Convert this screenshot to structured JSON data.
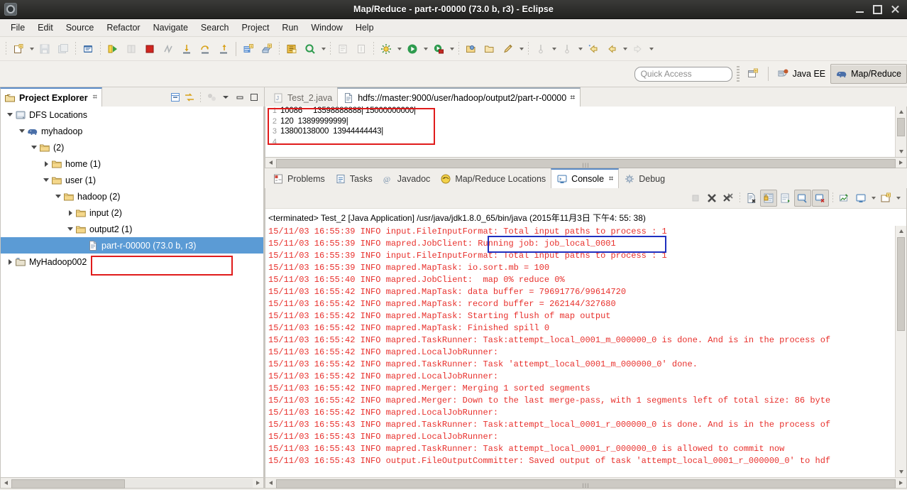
{
  "window": {
    "title": "Map/Reduce - part-r-00000 (73.0 b, r3) - Eclipse",
    "app_icon": "eclipse-icon",
    "minimize": "minimize-button",
    "maximize": "maximize-button",
    "close": "close-button"
  },
  "menubar": {
    "items": [
      "File",
      "Edit",
      "Source",
      "Refactor",
      "Navigate",
      "Search",
      "Project",
      "Run",
      "Window",
      "Help"
    ]
  },
  "toolbar": {
    "quick_access_placeholder": "Quick Access",
    "perspectives": [
      {
        "label": "Java EE",
        "icon": "javaee-perspective-icon",
        "active": false
      },
      {
        "label": "Map/Reduce",
        "icon": "elephant-icon",
        "active": true
      }
    ],
    "open_perspective_icon": "open-perspective-icon"
  },
  "project_explorer": {
    "title": "Project Explorer",
    "close_glyph": "⌗",
    "tools": [
      "collapse-all-icon",
      "link-with-editor-icon",
      "focus-icon",
      "view-menu-icon",
      "minimize-icon",
      "maximize-icon"
    ],
    "tree": [
      {
        "label": "DFS Locations",
        "indent": 0,
        "twist": "open",
        "icon": "dfs-locations-icon",
        "selected": false
      },
      {
        "label": "myhadoop",
        "indent": 1,
        "twist": "open",
        "icon": "elephant-icon",
        "selected": false
      },
      {
        "label": "(2)",
        "indent": 2,
        "twist": "open",
        "icon": "folder-icon",
        "selected": false
      },
      {
        "label": "home (1)",
        "indent": 3,
        "twist": "closed",
        "icon": "folder-icon",
        "selected": false
      },
      {
        "label": "user (1)",
        "indent": 3,
        "twist": "open",
        "icon": "folder-icon",
        "selected": false
      },
      {
        "label": "hadoop (2)",
        "indent": 4,
        "twist": "open",
        "icon": "folder-icon",
        "selected": false
      },
      {
        "label": "input (2)",
        "indent": 5,
        "twist": "closed",
        "icon": "folder-icon",
        "selected": false
      },
      {
        "label": "output2 (1)",
        "indent": 5,
        "twist": "open",
        "icon": "folder-icon",
        "selected": false
      },
      {
        "label": "part-r-00000 (73.0 b, r3)",
        "indent": 6,
        "twist": "none",
        "icon": "file-icon",
        "selected": true
      },
      {
        "label": "MyHadoop002",
        "indent": 0,
        "twist": "closed",
        "icon": "project-icon",
        "selected": false
      }
    ]
  },
  "editor": {
    "tabs": [
      {
        "label": "Test_2.java",
        "icon": "java-file-icon",
        "active": false
      },
      {
        "label": "hdfs://master:9000/user/hadoop/output2/part-r-00000",
        "icon": "file-icon",
        "active": true,
        "close_glyph": "⌗"
      }
    ],
    "lines": [
      {
        "num": "1",
        "text": "10086     13598888888| 15000000000|"
      },
      {
        "num": "2",
        "text": "120  13899999999|"
      },
      {
        "num": "3",
        "text": "13800138000  13944444443|"
      },
      {
        "num": "4",
        "text": ""
      }
    ]
  },
  "bottom_panel": {
    "tabs": [
      {
        "label": "Problems",
        "icon": "problems-icon",
        "active": false
      },
      {
        "label": "Tasks",
        "icon": "tasks-icon",
        "active": false
      },
      {
        "label": "Javadoc",
        "icon": "javadoc-icon",
        "active": false
      },
      {
        "label": "Map/Reduce Locations",
        "icon": "mapreduce-locations-icon",
        "active": false
      },
      {
        "label": "Console",
        "icon": "console-icon",
        "active": true,
        "close_glyph": "⌗"
      },
      {
        "label": "Debug",
        "icon": "debug-icon",
        "active": false
      }
    ],
    "console_tools": [
      "terminate-icon",
      "remove-launch-icon",
      "remove-all-launches-icon",
      "clear-console-icon",
      "scroll-lock-icon",
      "word-wrap-icon",
      "show-console-on-output-icon",
      "show-console-on-error-icon",
      "pin-console-icon",
      "display-selected-console-icon",
      "open-console-icon"
    ],
    "terminated_line": "<terminated> Test_2 [Java Application] /usr/java/jdk1.8.0_65/bin/java (2015年11月3日 下午4: 55: 38)",
    "highlight_text": "Running job: job_local_0001",
    "log_lines": [
      "15/11/03 16:55:39 INFO input.FileInputFormat: Total input paths to process : 1",
      "15/11/03 16:55:39 INFO mapred.JobClient: Running job: job_local_0001",
      "15/11/03 16:55:39 INFO input.FileInputFormat: Total input paths to process : 1",
      "15/11/03 16:55:39 INFO mapred.MapTask: io.sort.mb = 100",
      "15/11/03 16:55:40 INFO mapred.JobClient:  map 0% reduce 0%",
      "15/11/03 16:55:42 INFO mapred.MapTask: data buffer = 79691776/99614720",
      "15/11/03 16:55:42 INFO mapred.MapTask: record buffer = 262144/327680",
      "15/11/03 16:55:42 INFO mapred.MapTask: Starting flush of map output",
      "15/11/03 16:55:42 INFO mapred.MapTask: Finished spill 0",
      "15/11/03 16:55:42 INFO mapred.TaskRunner: Task:attempt_local_0001_m_000000_0 is done. And is in the process of",
      "15/11/03 16:55:42 INFO mapred.LocalJobRunner:",
      "15/11/03 16:55:42 INFO mapred.TaskRunner: Task 'attempt_local_0001_m_000000_0' done.",
      "15/11/03 16:55:42 INFO mapred.LocalJobRunner:",
      "15/11/03 16:55:42 INFO mapred.Merger: Merging 1 sorted segments",
      "15/11/03 16:55:42 INFO mapred.Merger: Down to the last merge-pass, with 1 segments left of total size: 86 byte",
      "15/11/03 16:55:42 INFO mapred.LocalJobRunner:",
      "15/11/03 16:55:43 INFO mapred.TaskRunner: Task:attempt_local_0001_r_000000_0 is done. And is in the process of",
      "15/11/03 16:55:43 INFO mapred.LocalJobRunner:",
      "15/11/03 16:55:43 INFO mapred.TaskRunner: Task attempt_local_0001_r_000000_0 is allowed to commit now",
      "15/11/03 16:55:43 INFO output.FileOutputCommitter: Saved output of task 'attempt_local_0001_r_000000_0' to hdf"
    ]
  },
  "colors": {
    "log_text": "#e8302c",
    "annotation_red": "#e01b1b",
    "annotation_blue": "#1f2fbf",
    "selection_blue": "#5b9bd5"
  }
}
